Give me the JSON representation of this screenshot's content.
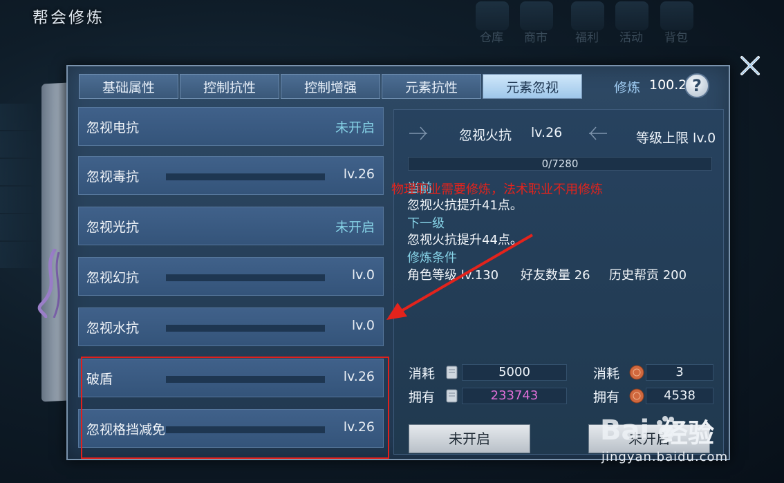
{
  "window": {
    "title": "帮会修炼"
  },
  "background_ui": {
    "labels": [
      "仓库",
      "商市",
      "福利",
      "活动",
      "背包"
    ]
  },
  "tabs": [
    {
      "label": "基础属性",
      "active": false
    },
    {
      "label": "控制抗性",
      "active": false
    },
    {
      "label": "控制增强",
      "active": false
    },
    {
      "label": "元素抗性",
      "active": false
    },
    {
      "label": "元素忽视",
      "active": true
    }
  ],
  "cultivation": {
    "label": "修炼",
    "value": "100.2"
  },
  "skills": [
    {
      "name": "忽视电抗",
      "status": "未开启"
    },
    {
      "name": "忽视毒抗",
      "level": "lv.26"
    },
    {
      "name": "忽视光抗",
      "status": "未开启"
    },
    {
      "name": "忽视幻抗",
      "level": "lv.0"
    },
    {
      "name": "忽视水抗",
      "level": "lv.0"
    },
    {
      "name": "破盾",
      "level": "lv.26"
    },
    {
      "name": "忽视格挡减免",
      "level": "lv.26"
    }
  ],
  "detail": {
    "name": "忽视火抗",
    "level": "lv.26",
    "cap": "等级上限 lv.0",
    "exp": "0/7280",
    "current_label": "当前",
    "current_text": "忽视火抗提升41点。",
    "next_label": "下一级",
    "next_text": "忽视火抗提升44点。",
    "cond_label": "修炼条件",
    "conditions": [
      "角色等级 lv.130",
      "好友数量 26",
      "历史帮贡 200"
    ]
  },
  "annotation": "物理职业需要修炼，法术职业不用修炼",
  "costs": {
    "consume_label": "消耗",
    "own_label": "拥有",
    "scroll_consume": "5000",
    "scroll_own": "233743",
    "coin_consume": "3",
    "coin_own": "4538"
  },
  "buttons": {
    "left": "未开启",
    "right": "未开启"
  },
  "watermark": {
    "text": "经验",
    "url": "jingyan.baidu.com"
  },
  "colors": {
    "highlight": "#e0201c",
    "annotation": "#e3231c",
    "unopened": "#86d2e6",
    "owned_scroll": "#e06fd8"
  }
}
